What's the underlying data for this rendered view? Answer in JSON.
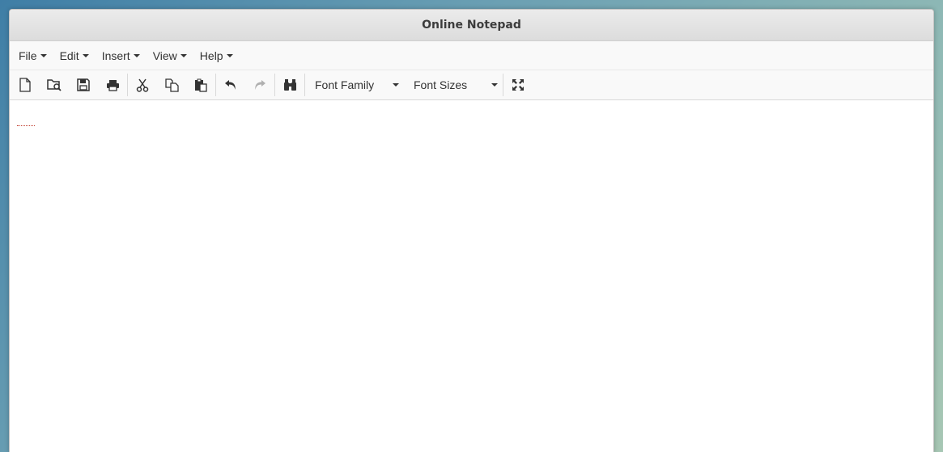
{
  "window": {
    "title": "Online Notepad"
  },
  "menubar": {
    "items": [
      {
        "label": "File"
      },
      {
        "label": "Edit"
      },
      {
        "label": "Insert"
      },
      {
        "label": "View"
      },
      {
        "label": "Help"
      }
    ]
  },
  "toolbar": {
    "icons": [
      "new-document-icon",
      "open-file-icon",
      "save-icon",
      "print-icon",
      "cut-icon",
      "copy-icon",
      "paste-icon",
      "undo-icon",
      "redo-icon",
      "find-icon",
      "fullscreen-icon"
    ],
    "font_family_label": "Font Family",
    "font_sizes_label": "Font Sizes"
  },
  "editor": {
    "content": ""
  },
  "colors": {
    "icon": "#333333",
    "icon_disabled": "#b0b0b0",
    "spellcheck": "#c0392b"
  }
}
